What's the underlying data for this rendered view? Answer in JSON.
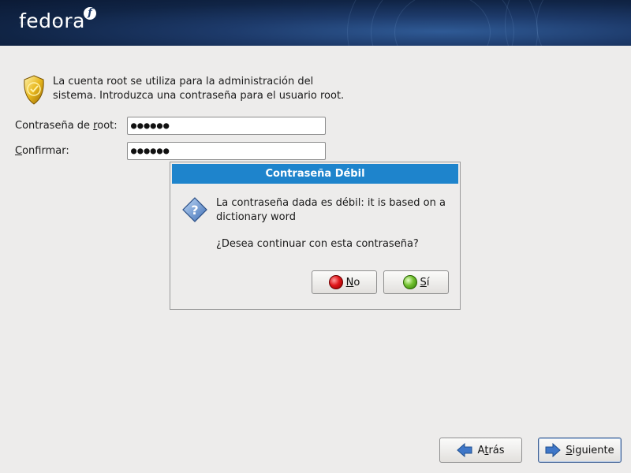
{
  "header": {
    "logo_text": "fedora",
    "logo_badge": "f"
  },
  "intro": {
    "icon": "shield-badge-icon",
    "line1": "La cuenta root se utiliza para la administración del",
    "line2": "sistema. Introduzca una contraseña para el usuario root."
  },
  "form": {
    "root_password_label_pre": "Contraseña de ",
    "root_password_label_u": "r",
    "root_password_label_post": "oot:",
    "root_password_value": "●●●●●●",
    "confirm_label_u": "C",
    "confirm_label_post": "onfirmar:",
    "confirm_value": "●●●●●●"
  },
  "dialog": {
    "title": "Contraseña Débil",
    "icon": "question-icon",
    "message_line1": "La contraseña dada es débil: it is based on a",
    "message_line2": "dictionary word",
    "question": "¿Desea continuar con esta contraseña?",
    "no_label_u": "N",
    "no_label_post": "o",
    "yes_label_u": "S",
    "yes_label_post": "í"
  },
  "nav": {
    "back_label_pre": "A",
    "back_label_u": "t",
    "back_label_post": "rás",
    "next_label_u": "S",
    "next_label_post": "iguiente"
  },
  "colors": {
    "dialog_title_bg": "#1e84cc",
    "header_bg": "#102445",
    "page_bg": "#edeceb"
  }
}
